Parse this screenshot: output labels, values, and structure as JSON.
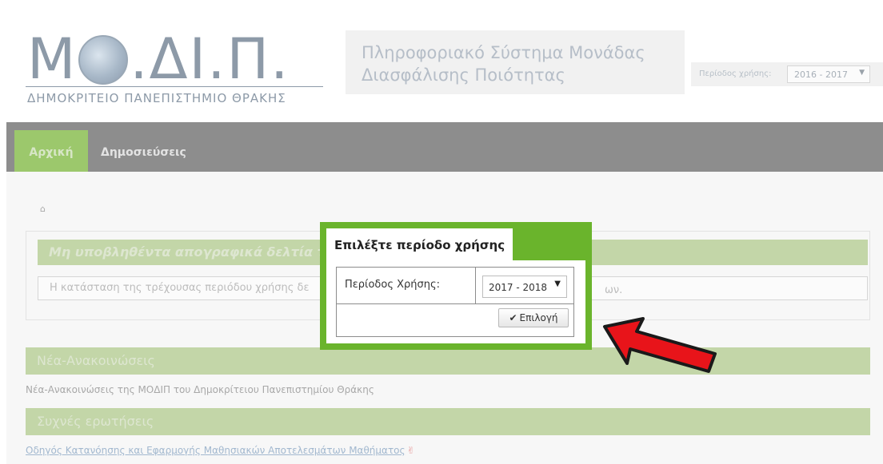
{
  "header": {
    "logo_main": "Μ",
    "logo_tail": ".ΔΙ.Π.",
    "logo_subtitle": "ΔΗΜΟΚΡΙΤΕΙΟ ΠΑΝΕΠΙΣΤΗΜΙΟ ΘΡΑΚΗΣ",
    "system_title": "Πληροφοριακό Σύστημα Μονάδας Διασφάλισης Ποιότητας",
    "period_label": "Περίοδος χρήσης:",
    "period_value": "2016 - 2017"
  },
  "nav": {
    "items": [
      {
        "label": "Αρχική",
        "active": true
      },
      {
        "label": "Δημοσιεύσεις",
        "active": false
      }
    ]
  },
  "content": {
    "home_icon": "home-icon",
    "panel_title": "Μη υποβληθέντα απογραφικά δελτία τρέχ",
    "panel_text": "Η κατάσταση της τρέχουσας περιόδου χρήσης δε",
    "panel_text_tail": "ων.",
    "news_title": "Νέα-Ανακοινώσεις",
    "news_text": "Νέα-Ανακοινώσεις της ΜΟΔΙΠ του Δημοκρίτειου Πανεπιστημίου Θράκης",
    "faq_title": "Συχνές ερωτήσεις",
    "faq_link": "Οδηγός Κατανόησης και Εφαρμογής Μαθησιακών Αποτελεσμάτων Μαθήματος"
  },
  "modal": {
    "title": "Επιλέξτε περίοδο χρήσης",
    "field_label": "Περίοδος Χρήσης:",
    "select_value": "2017 - 2018",
    "button_label": "Επιλογή"
  },
  "colors": {
    "accent_green": "#6ab42c",
    "arrow_red": "#e8141a"
  }
}
